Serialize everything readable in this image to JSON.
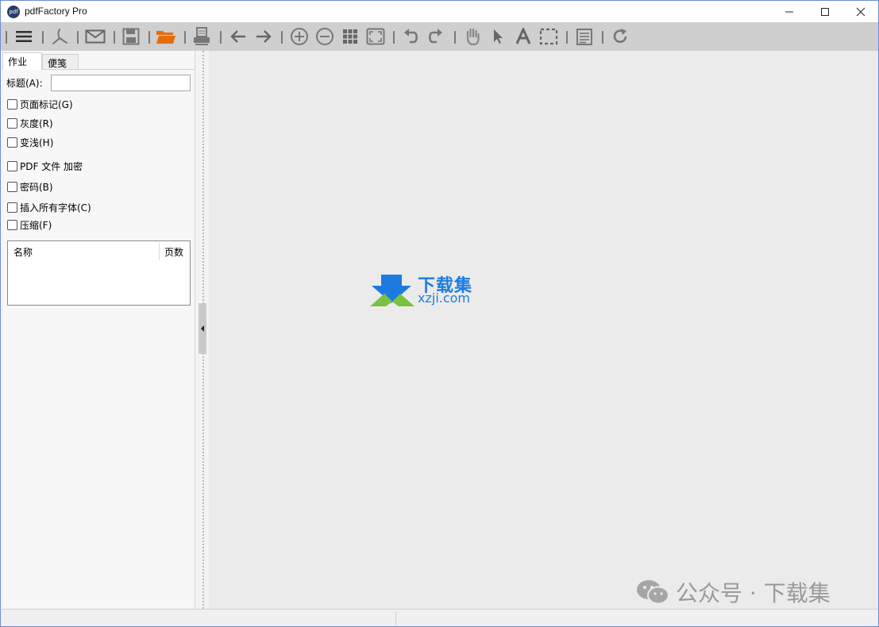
{
  "window": {
    "title": "pdfFactory Pro",
    "app_icon_text": "pdf"
  },
  "toolbar": {
    "items": [
      "menu-icon",
      "pdf-icon",
      "email-icon",
      "save-icon",
      "open-folder-icon",
      "print-icon",
      "back-icon",
      "forward-icon",
      "zoom-in-icon",
      "zoom-out-icon",
      "grid-view-icon",
      "fit-page-icon",
      "undo-icon",
      "redo-icon",
      "hand-tool-icon",
      "select-arrow-icon",
      "text-tool-icon",
      "marquee-select-icon",
      "notes-icon",
      "refresh-icon"
    ]
  },
  "tabs": {
    "job": "作业",
    "notes": "便笺"
  },
  "job": {
    "title_label": "标题(A):",
    "title_value": "",
    "options": {
      "page_marks": "页面标记(G)",
      "grayscale": "灰度(R)",
      "lighten": "变浅(H)",
      "pdf_encrypt": "PDF 文件 加密",
      "password": "密码(B)",
      "embed_fonts": "插入所有字体(C)",
      "compress": "压缩(F)"
    },
    "file_list": {
      "col_name": "名称",
      "col_pages": "页数"
    }
  },
  "preview": {
    "logo_title": "下载集",
    "logo_url": "xzji.com",
    "watermark": "公众号 · 下载集"
  },
  "colors": {
    "accent_blue": "#1d7be0",
    "logo_green": "#7cc242",
    "open_folder_orange": "#e46c0a",
    "toolbar_bg": "#cfcfcf"
  }
}
